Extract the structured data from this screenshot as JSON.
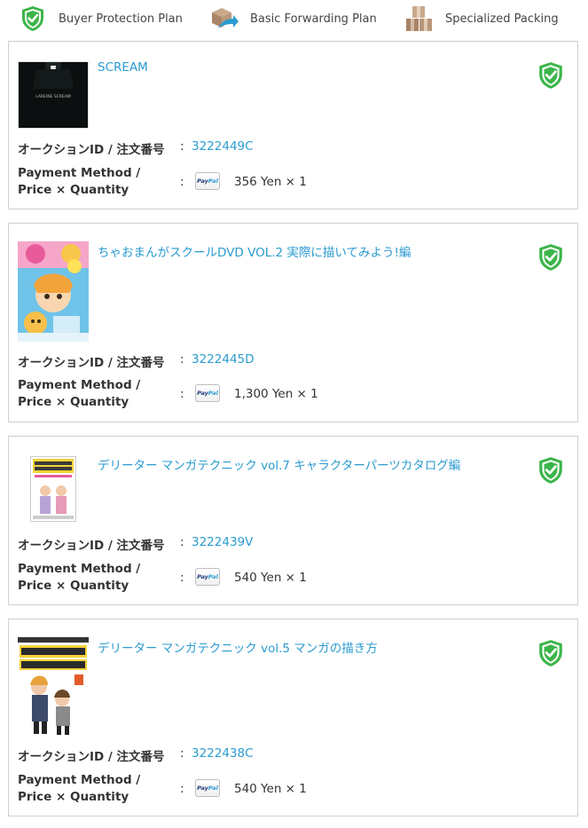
{
  "legend": {
    "buyer_protection": "Buyer Protection Plan",
    "basic_forwarding": "Basic Forwarding Plan",
    "specialized_packing": "Specialized Packing"
  },
  "labels": {
    "auction_id": "オークションID / 注文番号",
    "payment_line1": "Payment Method /",
    "payment_line2": "Price × Quantity",
    "colon": ":",
    "paypal_a": "Pay",
    "paypal_b": "Pal"
  },
  "thumb_texts": {
    "scream_cover": "LAREINE SCREAM"
  },
  "colors": {
    "link": "#2a9bd0",
    "shield_green": "#3cb54a",
    "border": "#cfcfcf"
  },
  "items": [
    {
      "title": "SCREAM",
      "auction_id": "3222449C",
      "price": "356 Yen × 1"
    },
    {
      "title": "ちゃおまんがスクールDVD VOL.2 実際に描いてみよう!編",
      "auction_id": "3222445D",
      "price": "1,300 Yen × 1"
    },
    {
      "title": "デリーター マンガテクニック vol.7 キャラクターパーツカタログ編",
      "auction_id": "3222439V",
      "price": "540 Yen × 1"
    },
    {
      "title": "デリーター マンガテクニック vol.5 マンガの描き方",
      "auction_id": "3222438C",
      "price": "540 Yen × 1"
    }
  ]
}
